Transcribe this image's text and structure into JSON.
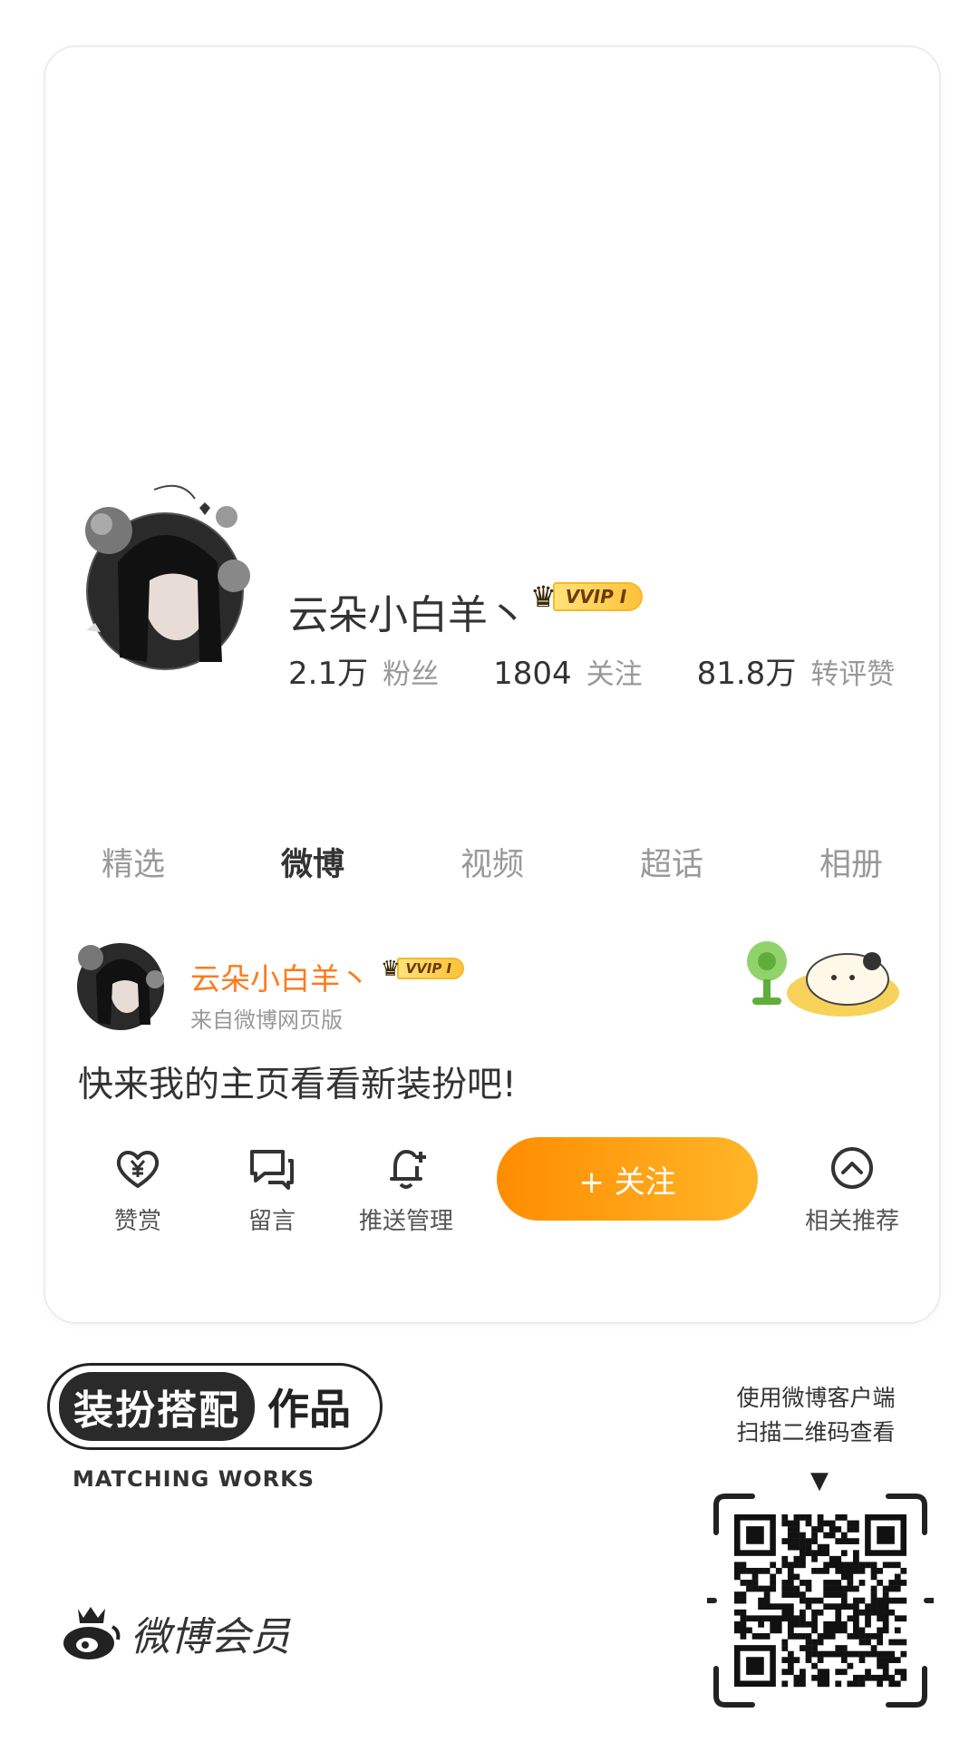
{
  "profile": {
    "name": "云朵小白羊丶",
    "vip_badge": "VVIP I",
    "stats": [
      {
        "value": "2.1万",
        "label": "粉丝"
      },
      {
        "value": "1804",
        "label": "关注"
      },
      {
        "value": "81.8万",
        "label": "转评赞"
      }
    ]
  },
  "tabs": [
    {
      "label": "精选",
      "active": false
    },
    {
      "label": "微博",
      "active": true
    },
    {
      "label": "视频",
      "active": false
    },
    {
      "label": "超话",
      "active": false
    },
    {
      "label": "相册",
      "active": false
    }
  ],
  "post": {
    "author": "云朵小白羊丶",
    "vip_badge": "VVIP I",
    "source": "来自微博网页版",
    "text": "快来我的主页看看新装扮吧!"
  },
  "actions": [
    {
      "label": "赞赏",
      "icon": "heart-yen-icon"
    },
    {
      "label": "留言",
      "icon": "message-icon"
    },
    {
      "label": "推送管理",
      "icon": "bell-plus-icon"
    },
    {
      "label": "相关推荐",
      "icon": "chevron-up-circle-icon"
    }
  ],
  "follow_button": "+ 关注",
  "footer": {
    "badge_main": "装扮搭配",
    "badge_side": "作品",
    "badge_en": "MATCHING WORKS",
    "brand": "微博会员",
    "qr_line1": "使用微博客户端",
    "qr_line2": "扫描二维码查看"
  },
  "colors": {
    "accent": "#ff8c00",
    "name_orange": "#ff7a1a",
    "text_dark": "#333333",
    "text_muted": "#999999"
  }
}
